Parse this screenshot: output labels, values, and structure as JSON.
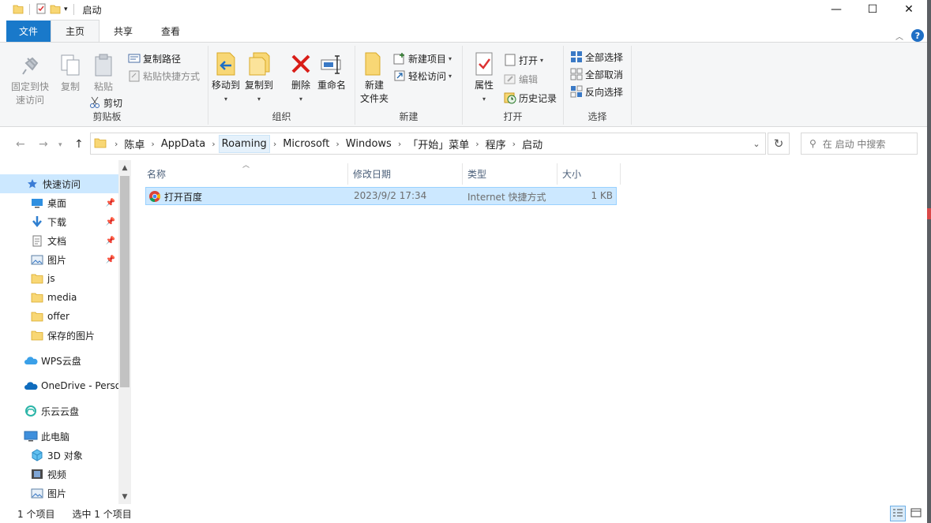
{
  "window": {
    "title": "启动",
    "controls": {
      "minimize": "—",
      "maximize": "☐",
      "close": "✕"
    }
  },
  "tabs": [
    {
      "label": "文件"
    },
    {
      "label": "主页"
    },
    {
      "label": "共享"
    },
    {
      "label": "查看"
    }
  ],
  "help_label": "?",
  "ribbon": {
    "clipboard": {
      "label": "剪贴板",
      "pin_line1": "固定到快",
      "pin_line2": "速访问",
      "copy": "复制",
      "paste": "粘贴",
      "copy_path": "复制路径",
      "paste_shortcut": "粘贴快捷方式",
      "cut": "剪切"
    },
    "organize": {
      "label": "组织",
      "move_to": "移动到",
      "copy_to": "复制到",
      "delete": "删除",
      "rename": "重命名"
    },
    "new": {
      "label": "新建",
      "new_folder_line1": "新建",
      "new_folder_line2": "文件夹",
      "new_item": "新建项目",
      "easy_access": "轻松访问"
    },
    "open": {
      "label": "打开",
      "properties": "属性",
      "open": "打开",
      "edit": "编辑",
      "history": "历史记录"
    },
    "select": {
      "label": "选择",
      "select_all": "全部选择",
      "select_none": "全部取消",
      "invert": "反向选择"
    }
  },
  "address": {
    "breadcrumbs": [
      "陈卓",
      "AppData",
      "Roaming",
      "Microsoft",
      "Windows",
      "「开始」菜单",
      "程序",
      "启动"
    ]
  },
  "search": {
    "placeholder": "在 启动 中搜索"
  },
  "nav_pane": {
    "items": [
      {
        "label": "快速访问",
        "icon": "star-icon"
      },
      {
        "label": "桌面",
        "icon": "desktop-icon",
        "pinned": true
      },
      {
        "label": "下载",
        "icon": "download-icon",
        "pinned": true
      },
      {
        "label": "文档",
        "icon": "document-icon",
        "pinned": true
      },
      {
        "label": "图片",
        "icon": "picture-icon",
        "pinned": true
      },
      {
        "label": "js",
        "icon": "folder-icon"
      },
      {
        "label": "media",
        "icon": "folder-icon"
      },
      {
        "label": "offer",
        "icon": "folder-icon"
      },
      {
        "label": "保存的图片",
        "icon": "folder-icon"
      },
      {
        "label": "WPS云盘",
        "icon": "cloud-icon"
      },
      {
        "label": "OneDrive - Perso",
        "icon": "onedrive-icon"
      },
      {
        "label": "乐云云盘",
        "icon": "cloud-icon"
      },
      {
        "label": "此电脑",
        "icon": "pc-icon"
      },
      {
        "label": "3D 对象",
        "icon": "3d-icon"
      },
      {
        "label": "视频",
        "icon": "video-icon"
      },
      {
        "label": "图片",
        "icon": "picture-icon"
      }
    ]
  },
  "file_list": {
    "columns": [
      "名称",
      "修改日期",
      "类型",
      "大小"
    ],
    "rows": [
      {
        "name": "打开百度",
        "modified": "2023/9/2 17:34",
        "type": "Internet 快捷方式",
        "size": "1 KB"
      }
    ]
  },
  "status": {
    "count": "1 个项目",
    "selected": "选中 1 个项目"
  },
  "colors": {
    "accent": "#1979ca",
    "selection": "#cce8ff"
  }
}
